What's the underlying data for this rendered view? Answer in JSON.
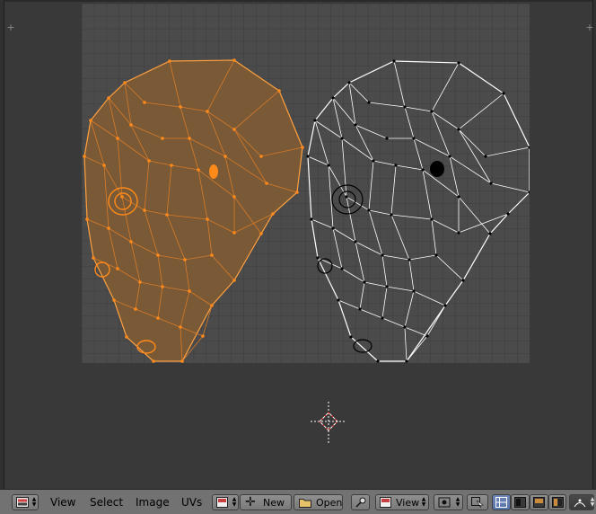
{
  "header": {
    "menus": [
      "View",
      "Select",
      "Image",
      "UVs"
    ],
    "new_label": "New",
    "open_label": "Open",
    "view_label": "View"
  },
  "colors": {
    "background": "#393939",
    "uv_grid": "#4b4b4b",
    "selected_face": "#7a5a36",
    "selected_vertex": "#ff8a1a",
    "unselected_wire": "#ffffff",
    "header": "#727272"
  },
  "icons": {
    "editor_type": "image-editor-icon",
    "image_browse": "image-icon",
    "new": "plus-icon",
    "open": "folder-icon",
    "pin": "pin-icon",
    "view_mode": "image-icon",
    "pivot": "pivot-icon",
    "sticky_select": "sticky-select-icon",
    "select_mode": [
      "vertex-select-icon",
      "edge-select-icon",
      "face-select-icon",
      "island-select-icon"
    ],
    "proportional": "proportional-edit-icon"
  }
}
